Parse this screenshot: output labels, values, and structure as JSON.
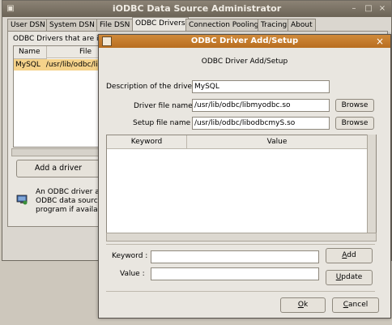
{
  "background_window": {
    "title": "iODBC Data Source Administrator",
    "tabs": [
      "User DSN",
      "System DSN",
      "File DSN",
      "ODBC Drivers",
      "Connection Pooling",
      "Tracing",
      "About"
    ],
    "active_tab": "ODBC Drivers",
    "header_text": "ODBC Drivers that are in",
    "columns": [
      "Name",
      "File"
    ],
    "row": {
      "name": "MySQL",
      "file": "/usr/lib/odbc/libm"
    },
    "add_driver_label": "Add a driver",
    "info_lines": [
      "An ODBC driver a",
      "ODBC data source",
      "program if availab"
    ]
  },
  "dialog": {
    "title": "ODBC Driver Add/Setup",
    "heading": "ODBC Driver Add/Setup",
    "description_label": "Description of the driver",
    "description_value": "MySQL",
    "driver_file_label": "Driver file name",
    "driver_file_value": "/usr/lib/odbc/libmyodbc.so",
    "setup_file_label": "Setup file name",
    "setup_file_value": "/usr/lib/odbc/libodbcmyS.so",
    "browse_label": "Browse",
    "columns": [
      "Keyword",
      "Value"
    ],
    "keyword_label": "Keyword :",
    "value_label": "Value :",
    "keyword_value": "",
    "value_value": "",
    "add_label": "Add",
    "update_label": "Update",
    "ok_label": "Ok",
    "cancel_label": "Cancel"
  },
  "colors": {
    "dialog_titlebar": "#c47a2c",
    "selected_row": "#f5d28a"
  }
}
